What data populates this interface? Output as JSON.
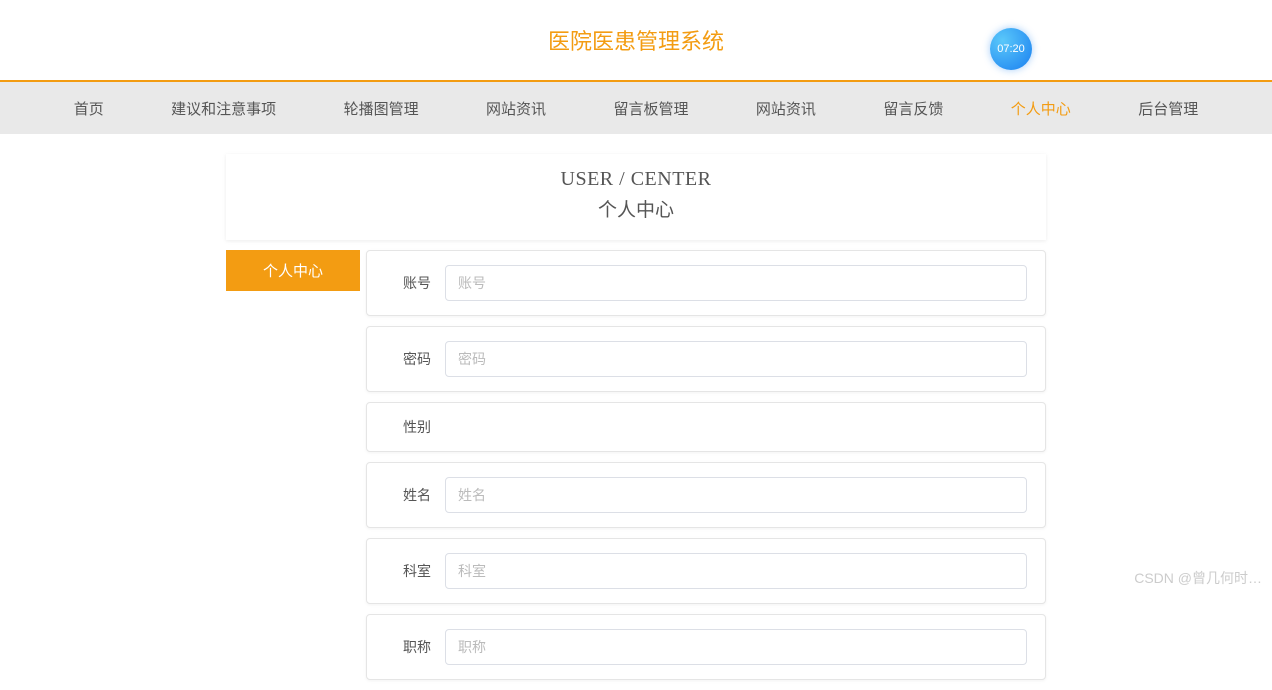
{
  "header": {
    "title": "医院医患管理系统",
    "clock": "07:20"
  },
  "nav": {
    "items": [
      {
        "label": "首页"
      },
      {
        "label": "建议和注意事项"
      },
      {
        "label": "轮播图管理"
      },
      {
        "label": "网站资讯"
      },
      {
        "label": "留言板管理"
      },
      {
        "label": "网站资讯"
      },
      {
        "label": "留言反馈"
      },
      {
        "label": "个人中心",
        "active": true
      },
      {
        "label": "后台管理"
      }
    ]
  },
  "page_header": {
    "en": "USER / CENTER",
    "cn": "个人中心"
  },
  "sidebar": {
    "items": [
      {
        "label": "个人中心",
        "active": true
      }
    ]
  },
  "form": {
    "fields": [
      {
        "label": "账号",
        "placeholder": "账号",
        "has_input": true
      },
      {
        "label": "密码",
        "placeholder": "密码",
        "has_input": true
      },
      {
        "label": "性别",
        "placeholder": "",
        "has_input": false
      },
      {
        "label": "姓名",
        "placeholder": "姓名",
        "has_input": true
      },
      {
        "label": "科室",
        "placeholder": "科室",
        "has_input": true
      },
      {
        "label": "职称",
        "placeholder": "职称",
        "has_input": true
      }
    ]
  },
  "watermark": "CSDN @曾几何时…"
}
